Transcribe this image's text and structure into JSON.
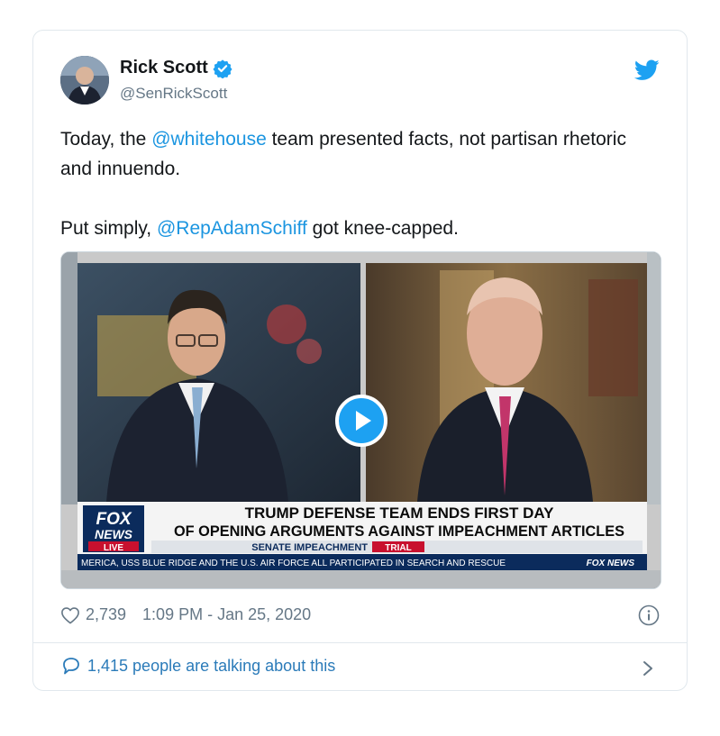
{
  "author": {
    "name": "Rick Scott",
    "handle": "@SenRickScott"
  },
  "tweet": {
    "line1_prefix": "Today, the ",
    "line1_mention": "@whitehouse",
    "line1_suffix": " team presented facts, not partisan rhetoric and innuendo.",
    "line2_prefix": "Put simply, ",
    "line2_mention": "@RepAdamSchiff",
    "line2_suffix": " got knee-capped."
  },
  "media": {
    "network_top": "FOX",
    "network_mid": "NEWS",
    "network_live": "LIVE",
    "headline_1": "TRUMP DEFENSE TEAM ENDS FIRST DAY",
    "headline_2": "OF OPENING ARGUMENTS AGAINST IMPEACHMENT ARTICLES",
    "subhead_1": "SENATE IMPEACHMENT",
    "subhead_2": "TRIAL",
    "ticker": "MERICA, USS BLUE RIDGE AND THE U.S. AIR FORCE ALL PARTICIPATED IN SEARCH AND RESCUE",
    "ticker_logo": "FOX NEWS"
  },
  "meta": {
    "likes": "2,739",
    "timestamp": "1:09 PM - Jan 25, 2020"
  },
  "footer": {
    "talking": "1,415 people are talking about this"
  },
  "colors": {
    "twitter_blue": "#1da1f2",
    "mention": "#1b95e0",
    "secondary_text": "#657786",
    "fox_red": "#c8102e",
    "fox_navy": "#0b2b5c"
  }
}
